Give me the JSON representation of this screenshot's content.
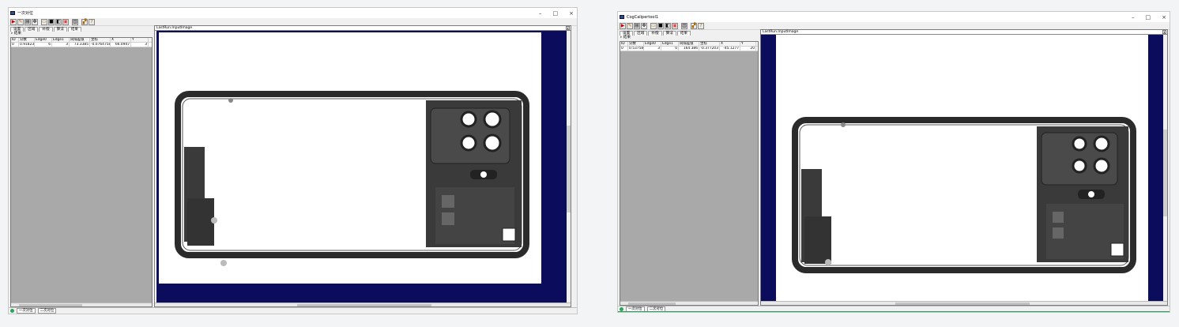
{
  "windowA": {
    "title": "一次对位",
    "window_controls": [
      "–",
      "□",
      "×"
    ],
    "toolbar_icons": [
      "run-icon",
      "edit-icon",
      "image-icon",
      "tool-icon",
      "open-icon",
      "save-icon",
      "grab-icon",
      "capture-icon",
      "display-icon",
      "chart-icon",
      "help-icon"
    ],
    "tabs": [
      "设置",
      "区域",
      "补偿",
      "算法",
      "结果"
    ],
    "tree_label": "结果",
    "grid": {
      "headers": [
        "ID",
        "分数",
        "Edge0",
        "Edge1",
        "间隔差值",
        "坐标",
        "X",
        "Y"
      ],
      "rows": [
        [
          "0",
          "0.918232",
          "6",
          "3",
          "73.3385",
          "-0.0764758",
          "66.0947",
          "3"
        ]
      ]
    },
    "image_combo": "LastRun.InputImage",
    "status_tabs": [
      "一次对位",
      "二次对位"
    ]
  },
  "windowB": {
    "title": "CogCalipertool1",
    "window_controls": [
      "–",
      "□",
      "×"
    ],
    "toolbar_icons": [
      "run-icon",
      "edit-icon",
      "image-icon",
      "tool-icon",
      "open-icon",
      "save-icon",
      "grab-icon",
      "capture-icon",
      "display-icon",
      "chart-icon",
      "help-icon"
    ],
    "tabs": [
      "设置",
      "区域",
      "补偿",
      "算法",
      "结果"
    ],
    "tree_label": "结果",
    "grid": {
      "headers": [
        "ID",
        "分数",
        "Edge0",
        "Edge1",
        "间隔差值",
        "坐标",
        "X",
        "Y"
      ],
      "rows": [
        [
          "0",
          "0.537580",
          "3",
          "0",
          "164.386",
          "-0.377203",
          "-45.1277",
          "20"
        ]
      ]
    },
    "image_combo": "LastRun.InputImage",
    "status_tabs": [
      "一次对位",
      "二次对位"
    ]
  }
}
